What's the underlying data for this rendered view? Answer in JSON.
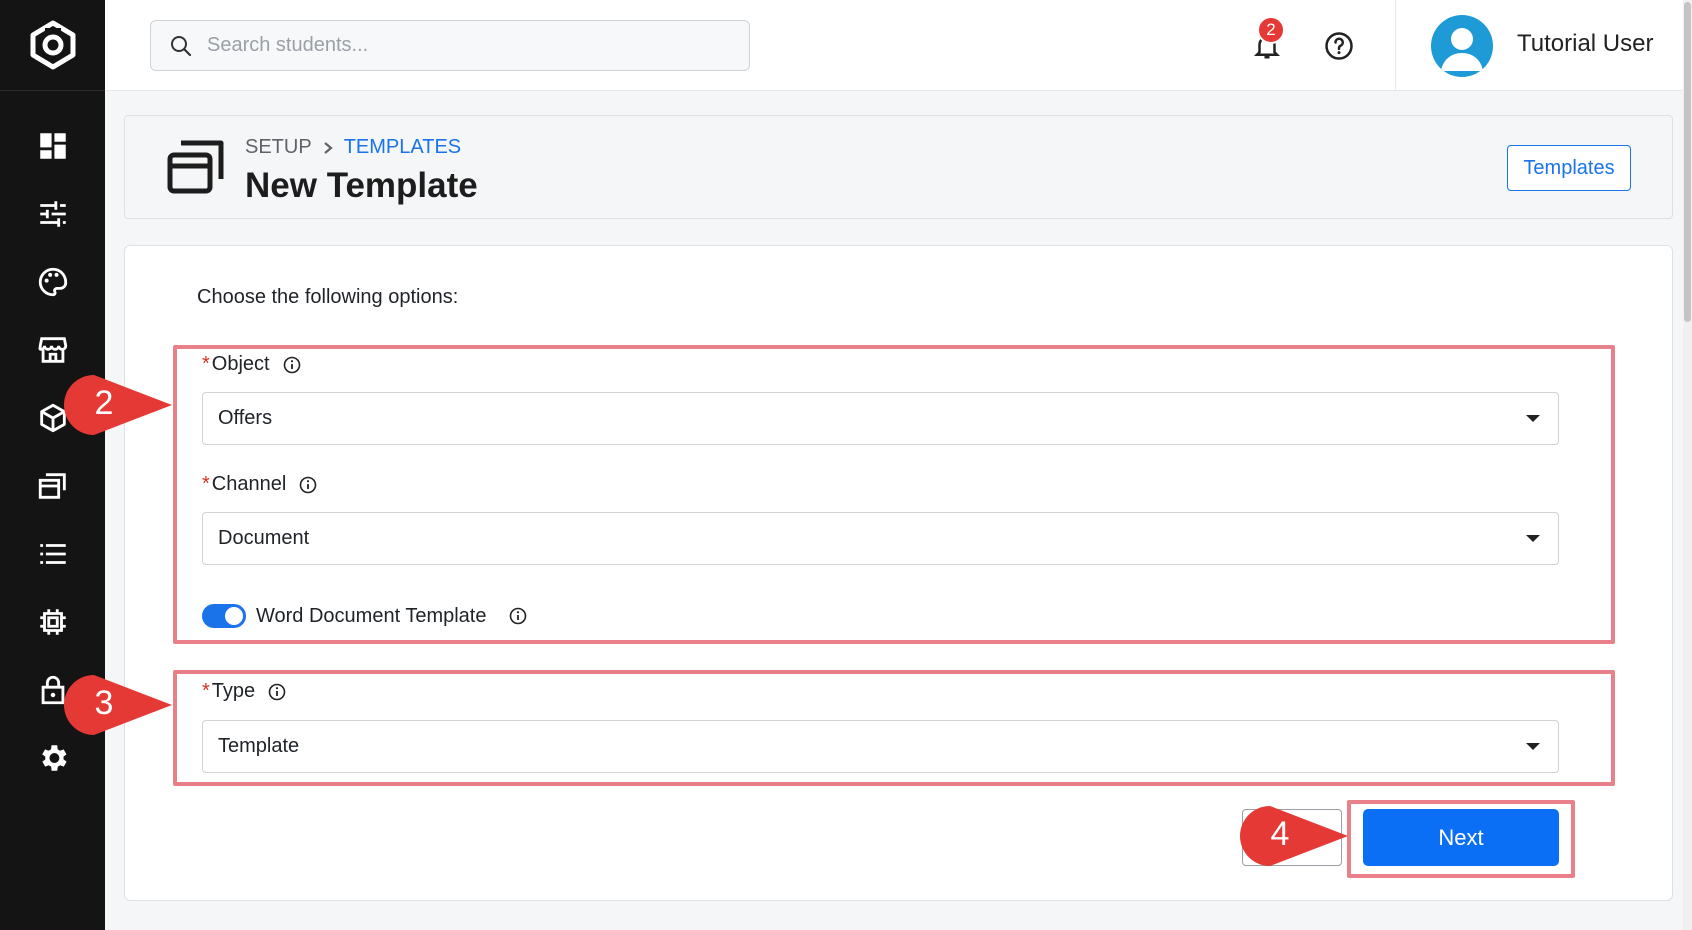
{
  "search": {
    "placeholder": "Search students..."
  },
  "notifications": {
    "count": "2"
  },
  "user": {
    "name": "Tutorial User"
  },
  "sidebar": {
    "items": [
      {
        "icon": "dashboard-icon"
      },
      {
        "icon": "sliders-icon"
      },
      {
        "icon": "palette-icon"
      },
      {
        "icon": "store-icon"
      },
      {
        "icon": "cube-icon"
      },
      {
        "icon": "windows-icon"
      },
      {
        "icon": "list-icon"
      },
      {
        "icon": "chip-icon"
      },
      {
        "icon": "lock-icon"
      },
      {
        "icon": "gear-icon"
      }
    ]
  },
  "breadcrumb": {
    "parent": "SETUP",
    "current": "TEMPLATES"
  },
  "page": {
    "title": "New Template",
    "templates_button": "Templates"
  },
  "form": {
    "intro": "Choose the following options:",
    "object": {
      "label": "Object",
      "value": "Offers"
    },
    "channel": {
      "label": "Channel",
      "value": "Document"
    },
    "word_template": {
      "label": "Word Document Template",
      "enabled": true
    },
    "type": {
      "label": "Type",
      "value": "Template"
    },
    "required_mark": "*",
    "next_button": "Next"
  },
  "callouts": [
    "2",
    "3",
    "4"
  ],
  "colors": {
    "accent": "#1a73e8",
    "primary_button": "#0b6ff5",
    "highlight": "#e8808a",
    "callout": "#e53935",
    "sidebar": "#141414"
  }
}
